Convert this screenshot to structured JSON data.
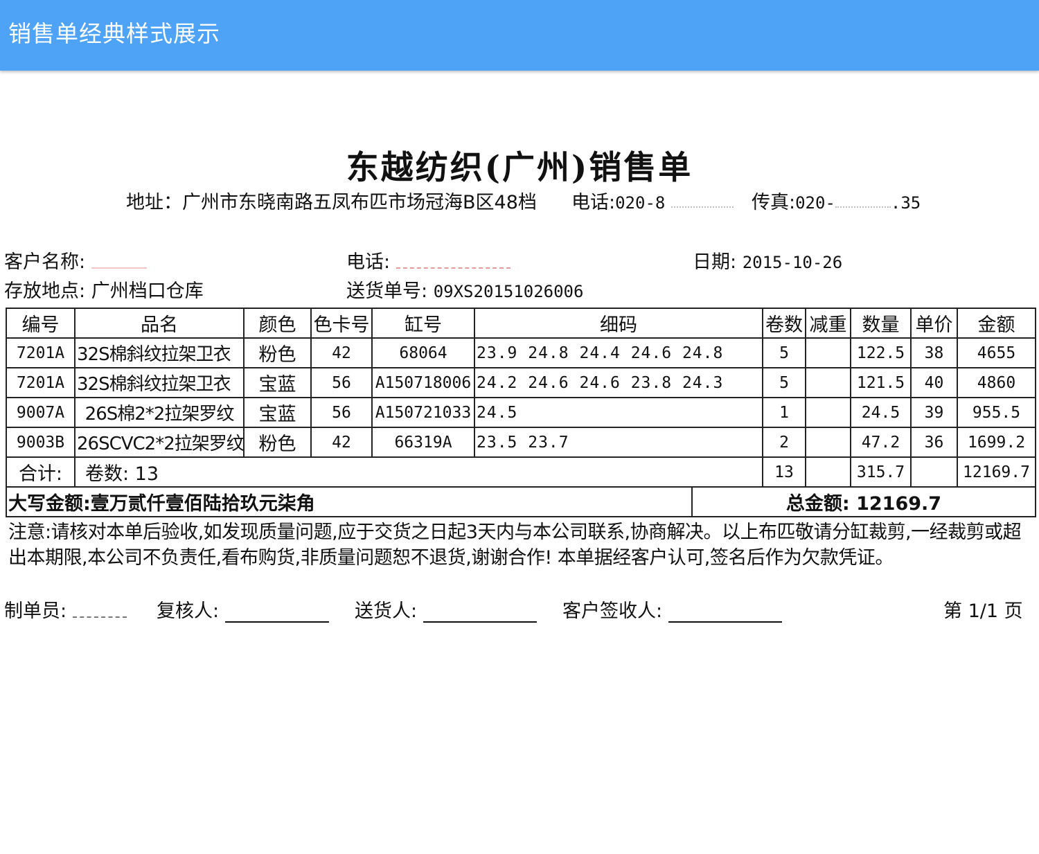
{
  "app": {
    "title": "销售单经典样式展示"
  },
  "doc": {
    "title": "东越纺织(广州)销售单",
    "address": "地址：广州市东晓南路五凤布匹市场冠海B区48档",
    "phone_label": "电话:",
    "phone_value": "020-8",
    "fax_label": "传真:",
    "fax_value": "020-",
    "fax_suffix": ".35"
  },
  "info": {
    "customer_label": "客户名称:",
    "customer_phone_label": "电话:",
    "date_label": "日期:",
    "date_value": "2015-10-26",
    "storage_label": "存放地点:",
    "storage_value": "广州档口仓库",
    "delivery_no_label": "送货单号:",
    "delivery_no_value": "09XS20151026006"
  },
  "table": {
    "headers": [
      "编号",
      "品名",
      "颜色",
      "色卡号",
      "缸号",
      "细码",
      "卷数",
      "减重",
      "数量",
      "单价",
      "金额"
    ],
    "rows": [
      [
        "7201A",
        "32S棉斜纹拉架卫衣",
        "粉色",
        "42",
        "68064",
        "23.9  24.8  24.4  24.6  24.8",
        "5",
        "",
        "122.5",
        "38",
        "4655"
      ],
      [
        "7201A",
        "32S棉斜纹拉架卫衣",
        "宝蓝",
        "56",
        "A150718006",
        "24.2  24.6  24.6  23.8  24.3",
        "5",
        "",
        "121.5",
        "40",
        "4860"
      ],
      [
        "9007A",
        "26S棉2*2拉架罗纹",
        "宝蓝",
        "56",
        "A150721033",
        "24.5",
        "1",
        "",
        "24.5",
        "39",
        "955.5"
      ],
      [
        "9003B",
        "26SCVC2*2拉架罗纹",
        "粉色",
        "42",
        "66319A",
        "23.5  23.7",
        "2",
        "",
        "47.2",
        "36",
        "1699.2"
      ]
    ],
    "total_label": "合计:",
    "total_rolls_text": "卷数: 13",
    "total_rolls": "13",
    "total_qty": "315.7",
    "total_amount": "12169.7"
  },
  "amount": {
    "uppercase": "大写金额:壹万贰仟壹佰陆拾玖元柒角",
    "total": "总金额: 12169.7"
  },
  "note": "注意:请核对本单后验收,如发现质量问题,应于交货之日起3天内与本公司联系,协商解决。以上布匹敬请分缸裁剪,一经裁剪或超出本期限,本公司不负责任,看布购货,非质量问题恕不退货,谢谢合作! 本单据经客户认可,签名后作为欠款凭证。",
  "footer": {
    "maker_label": "制单员:",
    "reviewer_label": "复核人:",
    "deliverer_label": "送货人:",
    "receiver_label": "客户签收人:",
    "page": "第 1/1 页"
  }
}
